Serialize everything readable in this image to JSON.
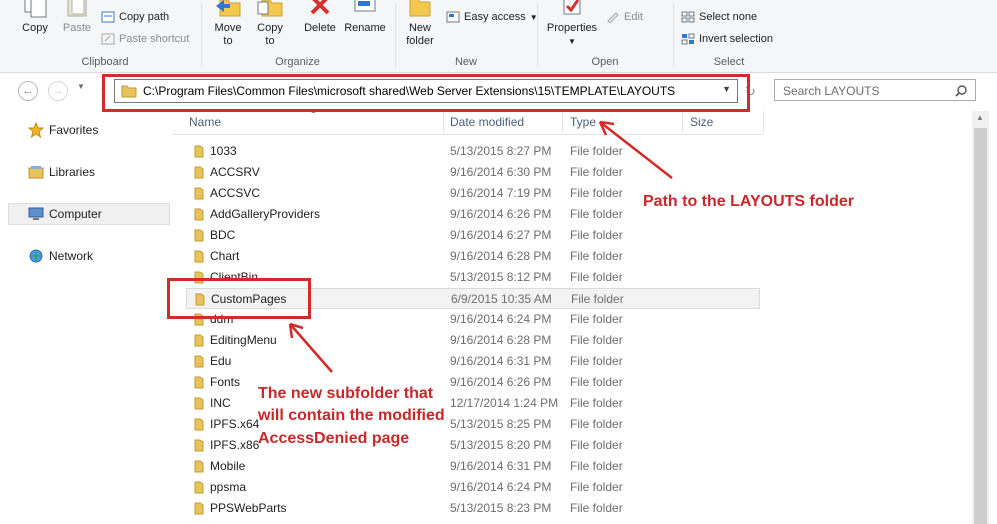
{
  "ribbon": {
    "copy": "Copy",
    "paste": "Paste",
    "copy_path": "Copy path",
    "paste_shortcut": "Paste shortcut",
    "move_to": "Move\nto",
    "copy_to": "Copy\nto",
    "delete": "Delete",
    "rename": "Rename",
    "new_folder": "New\nfolder",
    "easy_access": "Easy access",
    "properties": "Properties",
    "edit": "Edit",
    "select_none": "Select none",
    "invert_selection": "Invert selection",
    "groups": {
      "clipboard": "Clipboard",
      "organize": "Organize",
      "new": "New",
      "open": "Open",
      "select": "Select"
    }
  },
  "address": {
    "path": "C:\\Program Files\\Common Files\\microsoft shared\\Web Server Extensions\\15\\TEMPLATE\\LAYOUTS",
    "search_placeholder": "Search LAYOUTS"
  },
  "nav": {
    "favorites": "Favorites",
    "libraries": "Libraries",
    "computer": "Computer",
    "network": "Network"
  },
  "columns": {
    "name": "Name",
    "date": "Date modified",
    "type": "Type",
    "size": "Size"
  },
  "files": [
    {
      "name": "1033",
      "date": "5/13/2015 8:27 PM",
      "type": "File folder"
    },
    {
      "name": "ACCSRV",
      "date": "9/16/2014 6:30 PM",
      "type": "File folder"
    },
    {
      "name": "ACCSVC",
      "date": "9/16/2014 7:19 PM",
      "type": "File folder"
    },
    {
      "name": "AddGalleryProviders",
      "date": "9/16/2014 6:26 PM",
      "type": "File folder"
    },
    {
      "name": "BDC",
      "date": "9/16/2014 6:27 PM",
      "type": "File folder"
    },
    {
      "name": "Chart",
      "date": "9/16/2014 6:28 PM",
      "type": "File folder"
    },
    {
      "name": "ClientBin",
      "date": "5/13/2015 8:12 PM",
      "type": "File folder"
    },
    {
      "name": "CustomPages",
      "date": "6/9/2015 10:35 AM",
      "type": "File folder"
    },
    {
      "name": "ddm",
      "date": "9/16/2014 6:24 PM",
      "type": "File folder"
    },
    {
      "name": "EditingMenu",
      "date": "9/16/2014 6:28 PM",
      "type": "File folder"
    },
    {
      "name": "Edu",
      "date": "9/16/2014 6:31 PM",
      "type": "File folder"
    },
    {
      "name": "Fonts",
      "date": "9/16/2014 6:26 PM",
      "type": "File folder"
    },
    {
      "name": "INC",
      "date": "12/17/2014 1:24 PM",
      "type": "File folder"
    },
    {
      "name": "IPFS.x64",
      "date": "5/13/2015 8:25 PM",
      "type": "File folder"
    },
    {
      "name": "IPFS.x86",
      "date": "5/13/2015 8:20 PM",
      "type": "File folder"
    },
    {
      "name": "Mobile",
      "date": "9/16/2014 6:31 PM",
      "type": "File folder"
    },
    {
      "name": "ppsma",
      "date": "9/16/2014 6:24 PM",
      "type": "File folder"
    },
    {
      "name": "PPSWebParts",
      "date": "5/13/2015 8:23 PM",
      "type": "File folder"
    }
  ],
  "annotations": {
    "path_note": "Path to the LAYOUTS folder",
    "subfolder_note_1": "The new subfolder that",
    "subfolder_note_2": "will contain the modified",
    "subfolder_note_3": "AccessDenied page"
  },
  "colors": {
    "annotation": "#d42a2a",
    "folder": "#e8c25a"
  }
}
